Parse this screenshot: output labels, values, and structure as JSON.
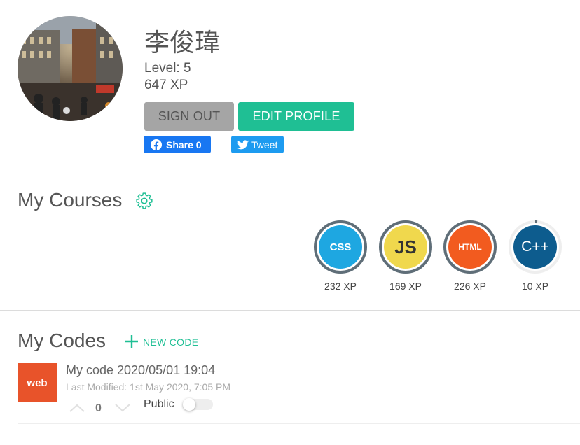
{
  "profile": {
    "name": "李俊瑋",
    "level": "Level: 5",
    "xp": "647 XP",
    "avatar_icon": "profile-photo"
  },
  "actions": {
    "sign_out": "SIGN OUT",
    "edit_profile": "EDIT PROFILE"
  },
  "social": {
    "facebook_label": "Share 0",
    "twitter_label": "Tweet"
  },
  "courses": {
    "title": "My Courses",
    "settings_icon": "gear-icon",
    "items": [
      {
        "name": "CSS",
        "xp": "232 XP",
        "color": "#1ea7e1"
      },
      {
        "name": "JS",
        "xp": "169 XP",
        "color": "#f0d84d"
      },
      {
        "name": "HTML",
        "xp": "226 XP",
        "color": "#f25b1f"
      },
      {
        "name": "C++",
        "xp": "10 XP",
        "color": "#0d5c8e"
      }
    ]
  },
  "codes": {
    "title": "My Codes",
    "new_code_label": "NEW CODE",
    "items": [
      {
        "thumb": "web",
        "title": "My code 2020/05/01 19:04",
        "modified": "Last Modified: 1st May 2020, 7:05 PM",
        "votes": "0",
        "public_label": "Public",
        "public": false
      }
    ]
  },
  "colors": {
    "accent": "#1fbf94",
    "signout_bg": "#a5a5a5",
    "facebook": "#1877f2",
    "twitter": "#1d9bf0"
  }
}
